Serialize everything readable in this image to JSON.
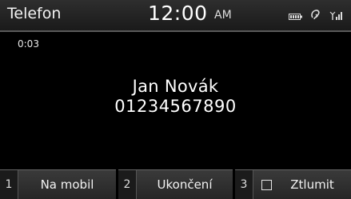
{
  "header": {
    "title": "Telefon",
    "time": "12:00",
    "ampm": "AM",
    "icons": [
      "battery-icon",
      "bluetooth-icon",
      "signal-icon"
    ]
  },
  "call": {
    "duration": "0:03",
    "contact_name": "Jan Novák",
    "phone_number": "01234567890"
  },
  "softkeys": [
    {
      "number": "1",
      "label": "Na mobil"
    },
    {
      "number": "2",
      "label": "Ukončení"
    },
    {
      "number": "3",
      "label": "Ztlumit",
      "checked": false
    }
  ],
  "colors": {
    "background": "#000000",
    "header_bg": "#2a2a2a",
    "softkey_bg": "#303030",
    "text": "#ffffff"
  }
}
